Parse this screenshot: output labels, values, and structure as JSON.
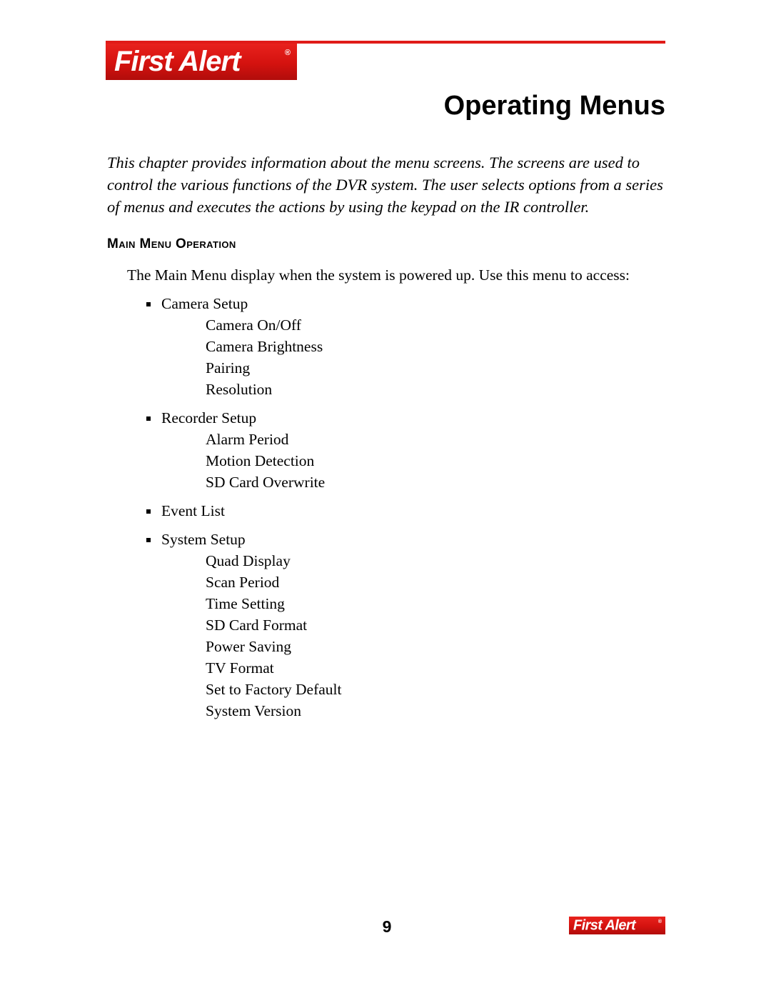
{
  "brand": {
    "logo_text": "First Alert",
    "registered_mark": "®",
    "brand_red": "#e01b18"
  },
  "header": {
    "title": "Operating Menus"
  },
  "intro": {
    "paragraph": "This chapter provides information about the menu screens. The screens are used to control the various functions of the DVR system. The user selects options from a series of menus and executes the actions by using the keypad on the IR controller."
  },
  "section": {
    "heading": "Main Menu Operation",
    "lead_line": "The Main Menu display when the system is powered up. Use this menu to access:",
    "groups": [
      {
        "label": "Camera Setup",
        "items": [
          "Camera On/Off",
          "Camera Brightness",
          "Pairing",
          "Resolution"
        ]
      },
      {
        "label": "Recorder Setup",
        "items": [
          "Alarm Period",
          "Motion Detection",
          "SD Card Overwrite"
        ]
      },
      {
        "label": "Event List",
        "items": []
      },
      {
        "label": "System Setup",
        "items": [
          "Quad Display",
          "Scan Period",
          "Time Setting",
          "SD Card Format",
          "Power Saving",
          "TV Format",
          "Set to Factory Default",
          "System Version"
        ]
      }
    ]
  },
  "footer": {
    "page_number": "9",
    "logo_text": "First Alert",
    "registered_mark": "®"
  }
}
